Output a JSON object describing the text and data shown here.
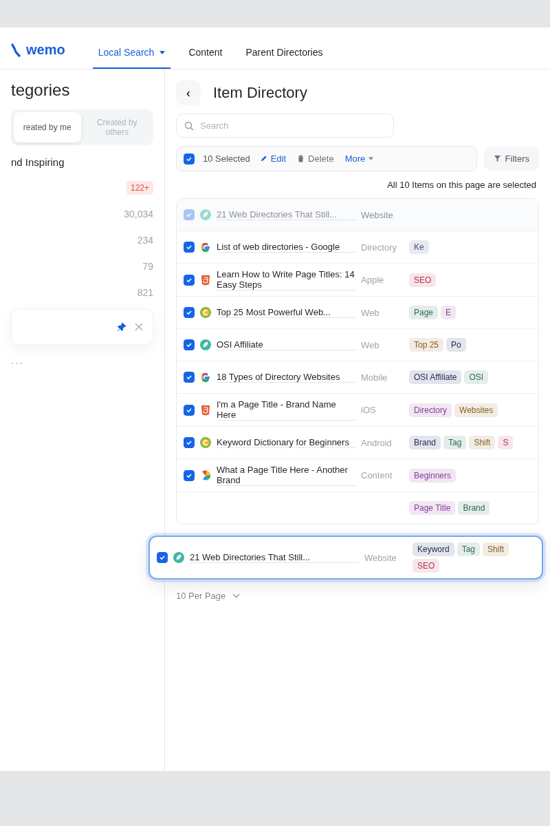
{
  "brand": {
    "name": "wemo"
  },
  "tabs": [
    {
      "label": "Local Search",
      "selected": true,
      "caret": true
    },
    {
      "label": "Content",
      "selected": false,
      "caret": false
    },
    {
      "label": "Parent Directories",
      "selected": false,
      "caret": false
    }
  ],
  "sidebar": {
    "title": "tegories",
    "segments": [
      {
        "label": "reated by me",
        "selected": true
      },
      {
        "label": "Created by others",
        "selected": false
      }
    ],
    "items": [
      {
        "label": "nd Inspiring"
      },
      {
        "badge": "122+"
      },
      {
        "count": "30,034"
      },
      {
        "count": "234"
      },
      {
        "count": "79"
      },
      {
        "count": "821"
      }
    ],
    "pinned_card": {
      "pinned": true,
      "closable": true
    },
    "more": "..."
  },
  "panel": {
    "back": "‹",
    "title": "Item Directory",
    "search": {
      "placeholder": "Search"
    },
    "bulk_bar": {
      "checked": true,
      "selected_label": "10 Selected",
      "actions": [
        {
          "kind": "edit",
          "label": "Edit"
        },
        {
          "kind": "delete",
          "label": "Delete"
        },
        {
          "kind": "more",
          "label": "More"
        }
      ]
    },
    "filters": "Filters",
    "banner": "All 10 Items on this page are selected",
    "rows": [
      {
        "kind": "leaf",
        "ghost": true,
        "checked": true,
        "title": "21 Web Directories That Still...",
        "column_3": "Website",
        "tags": []
      },
      {
        "kind": "google",
        "ghost": false,
        "checked": true,
        "title": "List of web directories - Google",
        "column_3": "Directory",
        "tags": [
          {
            "label": "Ke",
            "color": "#4a5080"
          }
        ]
      },
      {
        "kind": "html5",
        "ghost": false,
        "checked": true,
        "title": "Learn How to Write Page Titles: 14 Easy Steps",
        "column_3": "Apple",
        "tags": [
          {
            "label": "SEO",
            "color": "#b2334f"
          }
        ]
      },
      {
        "kind": "c-circle",
        "ghost": false,
        "checked": true,
        "title": "Top 25 Most Powerful Web...",
        "column_3": "Web",
        "tags": [
          {
            "label": "Page",
            "color": "#2a6b5e"
          },
          {
            "label": "E",
            "color": "#8b3b9a"
          }
        ]
      },
      {
        "kind": "leaf",
        "ghost": false,
        "checked": true,
        "title": "OSI Affiliate",
        "column_3": "Web",
        "tags": [
          {
            "label": "Top 25",
            "color": "#8a6020"
          },
          {
            "label": "Po",
            "color": "#1e2a5a"
          }
        ]
      },
      {
        "kind": "google",
        "ghost": false,
        "checked": true,
        "title": "18 Types of Directory Websites",
        "column_3": "Mobile",
        "tags": [
          {
            "label": "OSI Affiliate",
            "color": "#1e2a5a"
          },
          {
            "label": "OSI",
            "color": "#2a6b5e"
          }
        ]
      },
      {
        "kind": "html5",
        "ghost": false,
        "checked": true,
        "title": "I'm a Page Title - Brand Name Here",
        "column_3": "iOS",
        "tags": [
          {
            "label": "Directory",
            "color": "#8b3b9a"
          },
          {
            "label": "Websites",
            "color": "#8a6020"
          }
        ]
      },
      {
        "kind": "c-circle",
        "ghost": false,
        "checked": true,
        "title": "Keyword Dictionary for Beginners",
        "column_3": "Android",
        "tags": [
          {
            "label": "Brand",
            "color": "#1e2a5a"
          },
          {
            "label": "Tag",
            "color": "#2a6b5e"
          },
          {
            "label": "Shift",
            "color": "#8a6020"
          },
          {
            "label": "S",
            "color": "#b2334f"
          }
        ]
      },
      {
        "kind": "petals",
        "ghost": false,
        "checked": true,
        "title": "What a Page Title Here - Another Brand",
        "column_3": "Content",
        "tags": [
          {
            "label": "Beginners",
            "color": "#8b3b9a"
          }
        ]
      },
      {
        "kind": "none",
        "title": "",
        "column_3": "",
        "tags": [
          {
            "label": "Page Title",
            "color": "#8b3b9a"
          },
          {
            "label": "Brand",
            "color": "#2a6b5e"
          }
        ]
      }
    ],
    "per_page": "10 Per Page",
    "drag_card": {
      "kind": "leaf",
      "checked": true,
      "title": "21 Web Directories That Still...",
      "column_3": "Website",
      "tags": [
        {
          "label": "Keyword",
          "color": "#1e2a5a"
        },
        {
          "label": "Tag",
          "color": "#2a6b5e"
        },
        {
          "label": "Shift",
          "color": "#8a6020"
        },
        {
          "label": "SEO",
          "color": "#b2334f"
        }
      ]
    }
  }
}
